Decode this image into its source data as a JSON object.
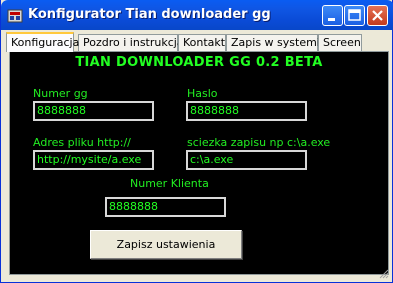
{
  "window": {
    "title": "Konfigurator Tian downloader gg",
    "icon": "app-icon"
  },
  "tabs": [
    {
      "label": "Konfiguracja",
      "active": true
    },
    {
      "label": "Pozdro i instrukcja",
      "active": false
    },
    {
      "label": "Kontakt",
      "active": false
    },
    {
      "label": "Zapis w systemie",
      "active": false
    },
    {
      "label": "Screen",
      "active": false
    }
  ],
  "panel": {
    "heading": "TIAN DOWNLOADER GG 0.2 BETA",
    "numer_gg": {
      "label": "Numer gg",
      "value": "8888888"
    },
    "haslo": {
      "label": "Haslo",
      "value": "8888888"
    },
    "adres": {
      "label": "Adres pliku http://",
      "value": "http://mysite/a.exe"
    },
    "sciezka": {
      "label": "sciezka zapisu np c:\\a.exe",
      "value": "c:\\a.exe"
    },
    "numer_klienta": {
      "label": "Numer Klienta",
      "value": "8888888"
    },
    "save_label": "Zapisz ustawienia"
  },
  "colors": {
    "panel_bg": "#000000",
    "text_green": "#22ff22",
    "title_bar": "#0a5cf2"
  }
}
